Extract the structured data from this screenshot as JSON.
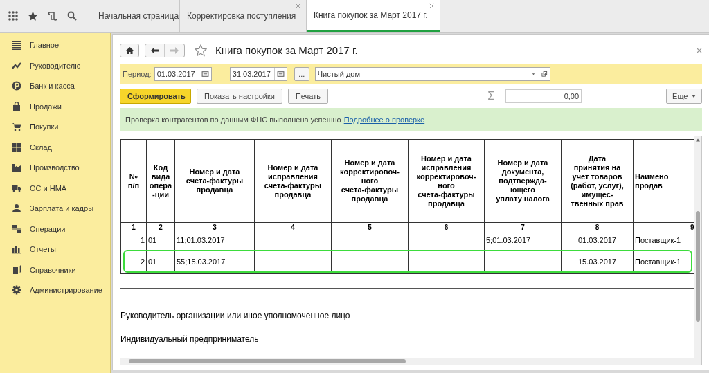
{
  "tabs": [
    {
      "label": "Начальная страница",
      "closable": false,
      "selected": false
    },
    {
      "label": "Корректировка поступления",
      "closable": true,
      "selected": false
    },
    {
      "label": "Книга покупок за Март 2017 г.",
      "closable": true,
      "selected": true
    }
  ],
  "sidebar": {
    "items": [
      {
        "label": "Главное"
      },
      {
        "label": "Руководителю"
      },
      {
        "label": "Банк и касса"
      },
      {
        "label": "Продажи"
      },
      {
        "label": "Покупки"
      },
      {
        "label": "Склад"
      },
      {
        "label": "Производство"
      },
      {
        "label": "ОС и НМА"
      },
      {
        "label": "Зарплата и кадры"
      },
      {
        "label": "Операции"
      },
      {
        "label": "Отчеты"
      },
      {
        "label": "Справочники"
      },
      {
        "label": "Администрирование"
      }
    ]
  },
  "document": {
    "title": "Книга покупок за Март 2017 г.",
    "favorite": false,
    "period_label": "Период:",
    "date_from": "01.03.2017",
    "dash": "–",
    "date_to": "31.03.2017",
    "ellipsis": "...",
    "organization": "Чистый дом",
    "buttons": [
      "Сформировать",
      "Показать настройки",
      "Печать"
    ],
    "sum_symbol": "Σ",
    "sum": "0,00",
    "more": "Еще",
    "notice": "Проверка контрагентов по данным ФНС выполнена успешно",
    "notice_link": "Подробнее о проверке"
  },
  "table": {
    "columns": [
      {
        "header": "№\nп/п",
        "number": "1"
      },
      {
        "header": "Код\nвида\nопера\n-ции",
        "number": "2"
      },
      {
        "header": "Номер и дата\nсчета-фактуры\nпродавца",
        "number": "3"
      },
      {
        "header": "Номер и дата\nисправления\nсчета-фактуры\nпродавца",
        "number": "4"
      },
      {
        "header": "Номер и дата\nкорректировоч-\nного\nсчета-фактуры\nпродавца",
        "number": "5"
      },
      {
        "header": "Номер и дата\nисправления\nкорректировоч-\nного\nсчета-фактуры\nпродавца",
        "number": "6"
      },
      {
        "header": "Номер и дата\nдокумента,\nподтвержда-\nющего\nуплату налога",
        "number": "7"
      },
      {
        "header": "Дата\nпринятия на\nучет  товаров\n(работ, услуг),\nимущес-\nтвенных прав",
        "number": "8"
      },
      {
        "header": "Наимено\nпродав",
        "number": "9"
      }
    ],
    "rows": [
      {
        "highlighted": false,
        "cells": [
          "1",
          "01",
          "11;01.03.2017",
          "",
          "",
          "",
          "5;01.03.2017",
          "01.03.2017",
          "Поставщик-1"
        ]
      },
      {
        "highlighted": true,
        "cells": [
          "2",
          "01",
          "55;15.03.2017",
          "",
          "",
          "",
          "",
          "15.03.2017",
          "Поставщик-1"
        ]
      }
    ]
  },
  "footer_lines": [
    "Руководитель организации или иное уполномоченное лицо",
    "Индивидуальный предприниматель"
  ]
}
